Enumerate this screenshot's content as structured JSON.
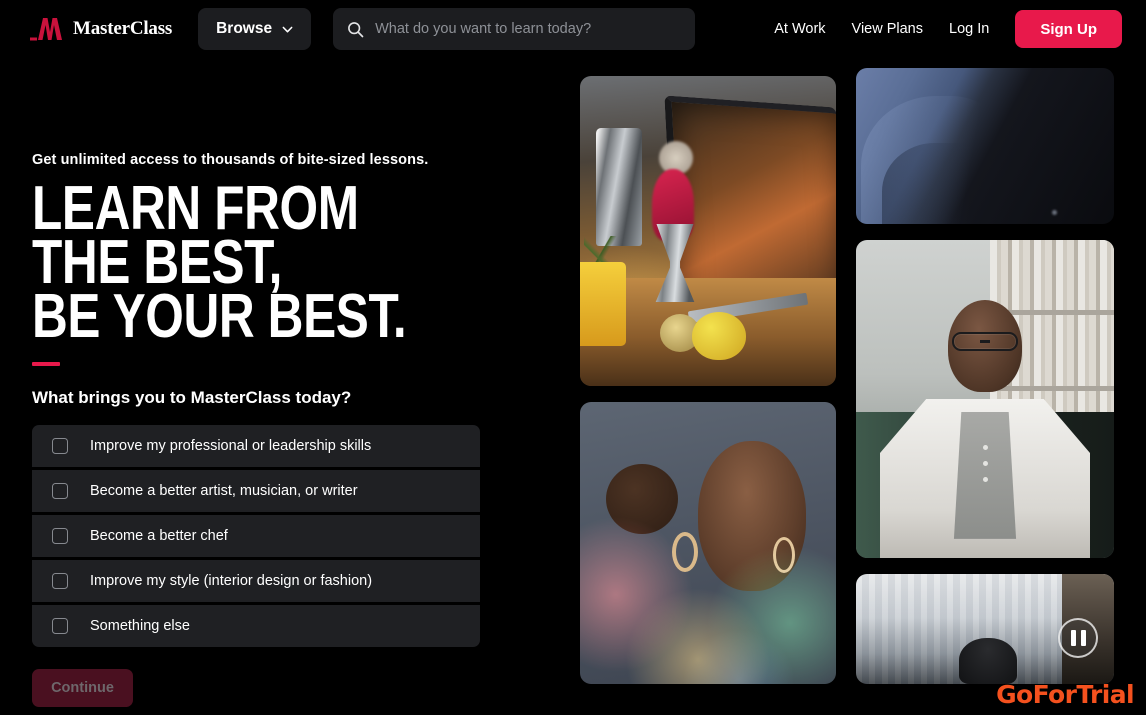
{
  "header": {
    "logo_text": "MasterClass",
    "logo_icon": "masterclass-m-logo",
    "browse_label": "Browse",
    "browse_icon": "chevron-down-icon",
    "search_icon": "search-icon",
    "search_placeholder": "What do you want to learn today?",
    "search_value": "",
    "nav_links": [
      {
        "label": "At Work"
      },
      {
        "label": "View Plans"
      },
      {
        "label": "Log In"
      }
    ],
    "signup_label": "Sign Up"
  },
  "hero": {
    "eyebrow": "Get unlimited access to thousands of bite-sized lessons.",
    "headline": "LEARN FROM THE BEST,\nBE YOUR BEST.",
    "question": "What brings you to MasterClass today?",
    "continue_label": "Continue",
    "continue_disabled": true,
    "options": [
      {
        "label": "Improve my professional or leadership skills",
        "checked": false
      },
      {
        "label": "Become a better artist, musician, or writer",
        "checked": false
      },
      {
        "label": "Become a better chef",
        "checked": false
      },
      {
        "label": "Improve my style (interior design or fashion)",
        "checked": false
      },
      {
        "label": "Something else",
        "checked": false
      }
    ]
  },
  "collage": {
    "cards": [
      {
        "name": "cocktail-bartending-lesson-thumbnail"
      },
      {
        "name": "blue-fabric-closeup-thumbnail"
      },
      {
        "name": "instructor-portrait-library-thumbnail"
      },
      {
        "name": "portrait-rainbow-light-thumbnail"
      },
      {
        "name": "curtain-scene-video-thumbnail"
      }
    ],
    "pause_icon": "pause-icon"
  },
  "watermark": {
    "text": "GoForTrial"
  },
  "colors": {
    "background": "#000000",
    "accent": "#e8194b",
    "surface": "#1f2023",
    "input_surface": "#1c1d20",
    "disabled_button": "#4a1020",
    "disabled_text": "#6e676b",
    "placeholder": "#8e9197",
    "watermark": "#f4511e"
  }
}
